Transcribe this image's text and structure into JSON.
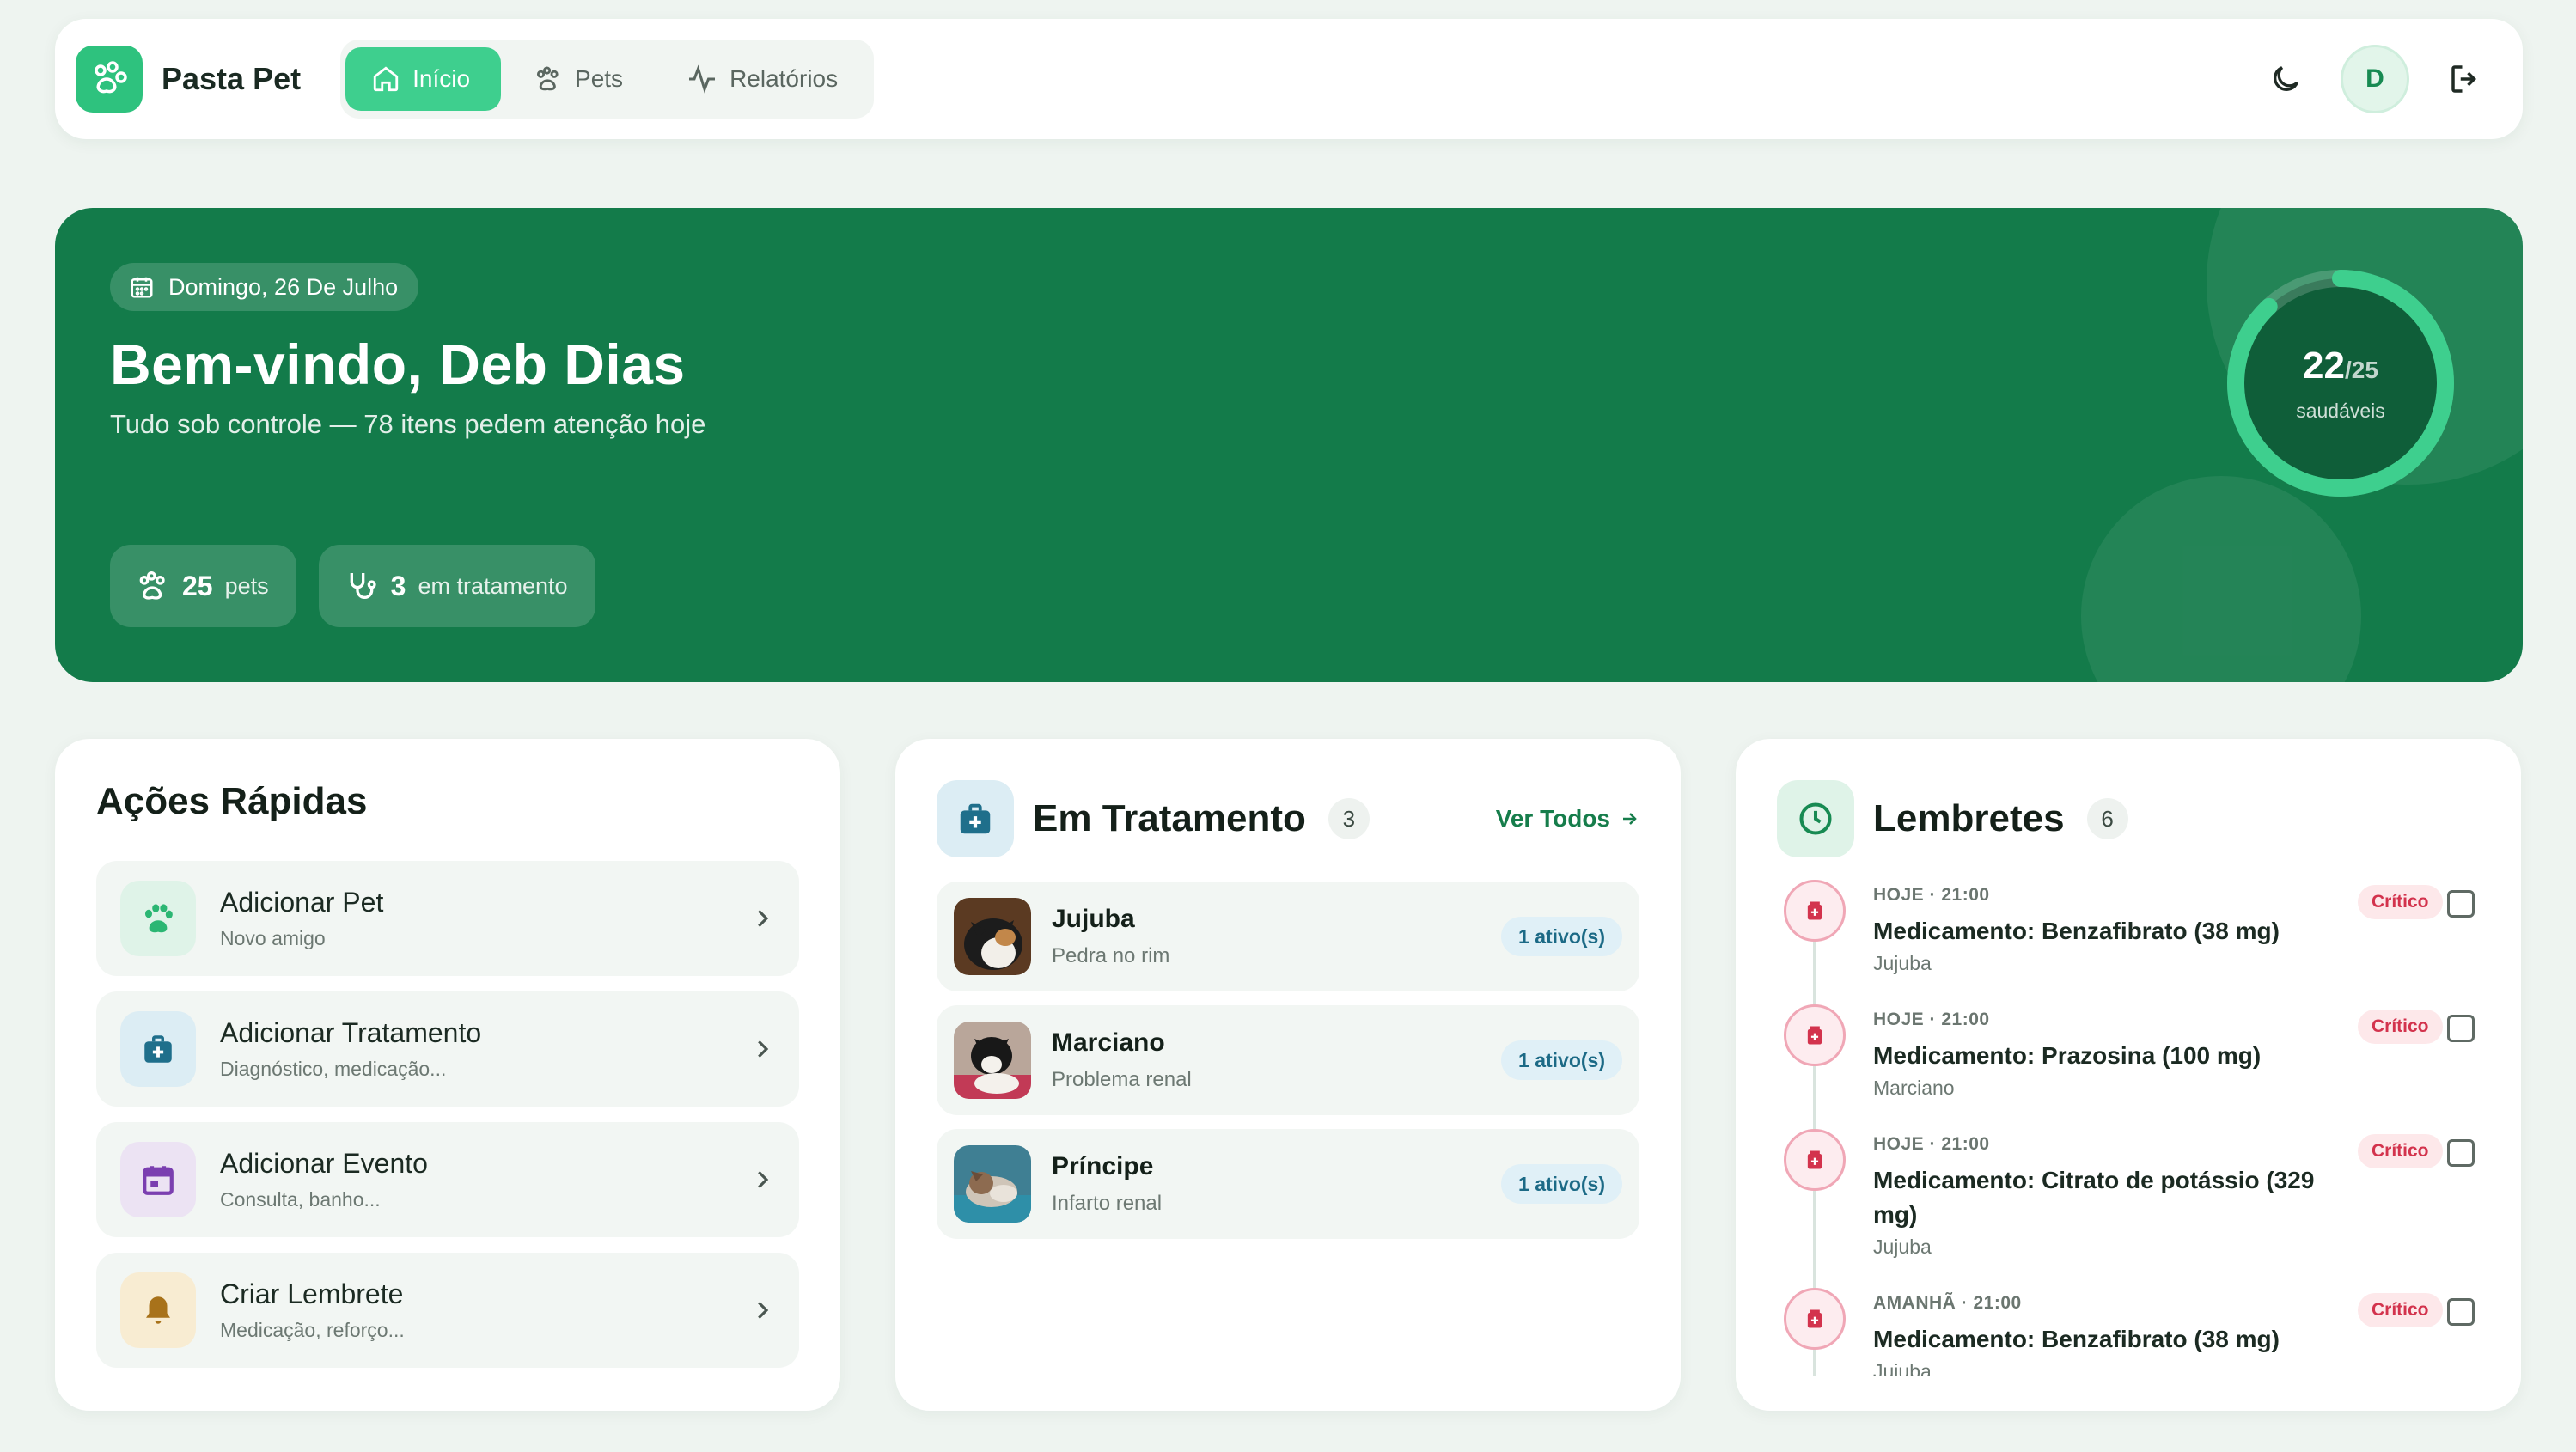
{
  "nav": {
    "brand": "Pasta Pet",
    "tabs": [
      {
        "label": "Início",
        "icon": "home-icon",
        "active": true
      },
      {
        "label": "Pets",
        "icon": "paw-icon",
        "active": false
      },
      {
        "label": "Relatórios",
        "icon": "activity-icon",
        "active": false
      }
    ],
    "avatar_initial": "D"
  },
  "hero": {
    "date": "Domingo, 26 De Julho",
    "greeting": "Bem-vindo, Deb Dias",
    "subtitle": "Tudo sob controle — 78 itens pedem atenção hoje",
    "stats": [
      {
        "value": "25",
        "label": "pets",
        "icon": "paw-icon"
      },
      {
        "value": "3",
        "label": "em tratamento",
        "icon": "stethoscope-icon"
      }
    ],
    "healthy": {
      "count": "22",
      "total": "/25",
      "caption": "saudáveis",
      "fraction": 0.88
    }
  },
  "quick_actions": {
    "title": "Ações Rápidas",
    "items": [
      {
        "label": "Adicionar Pet",
        "sub": "Novo amigo",
        "icon": "paw-icon",
        "color": "#2bb673",
        "bg": "#dff3e8"
      },
      {
        "label": "Adicionar Tratamento",
        "sub": "Diagnóstico, medicação...",
        "icon": "medical-kit-icon",
        "color": "#1f6f8b",
        "bg": "#dcedf4"
      },
      {
        "label": "Adicionar Evento",
        "sub": "Consulta, banho...",
        "icon": "calendar-icon",
        "color": "#7b3fb0",
        "bg": "#ece3f3"
      },
      {
        "label": "Criar Lembrete",
        "sub": "Medicação, reforço...",
        "icon": "bell-icon",
        "color": "#b8860b",
        "bg": "#f8ecd2"
      }
    ]
  },
  "treatment": {
    "title": "Em Tratamento",
    "count": "3",
    "see_all": "Ver Todos",
    "items": [
      {
        "name": "Jujuba",
        "condition": "Pedra no rim",
        "badge": "1 ativo(s)"
      },
      {
        "name": "Marciano",
        "condition": "Problema renal",
        "badge": "1 ativo(s)"
      },
      {
        "name": "Príncipe",
        "condition": "Infarto renal",
        "badge": "1 ativo(s)"
      }
    ]
  },
  "reminders": {
    "title": "Lembretes",
    "count": "6",
    "items": [
      {
        "when": "HOJE · 21:00",
        "title": "Medicamento: Benzafibrato (38 mg)",
        "pet": "Jujuba",
        "badge": "Crítico"
      },
      {
        "when": "HOJE · 21:00",
        "title": "Medicamento: Prazosina (100 mg)",
        "pet": "Marciano",
        "badge": "Crítico"
      },
      {
        "when": "HOJE · 21:00",
        "title": "Medicamento: Citrato de potássio (329 mg)",
        "pet": "Jujuba",
        "badge": "Crítico"
      },
      {
        "when": "AMANHÃ · 21:00",
        "title": "Medicamento: Benzafibrato (38 mg)",
        "pet": "Jujuba",
        "badge": "Crítico"
      }
    ]
  },
  "colors": {
    "primary": "#137b4a",
    "accent": "#3ecf8e",
    "critical": "#d3334d"
  }
}
